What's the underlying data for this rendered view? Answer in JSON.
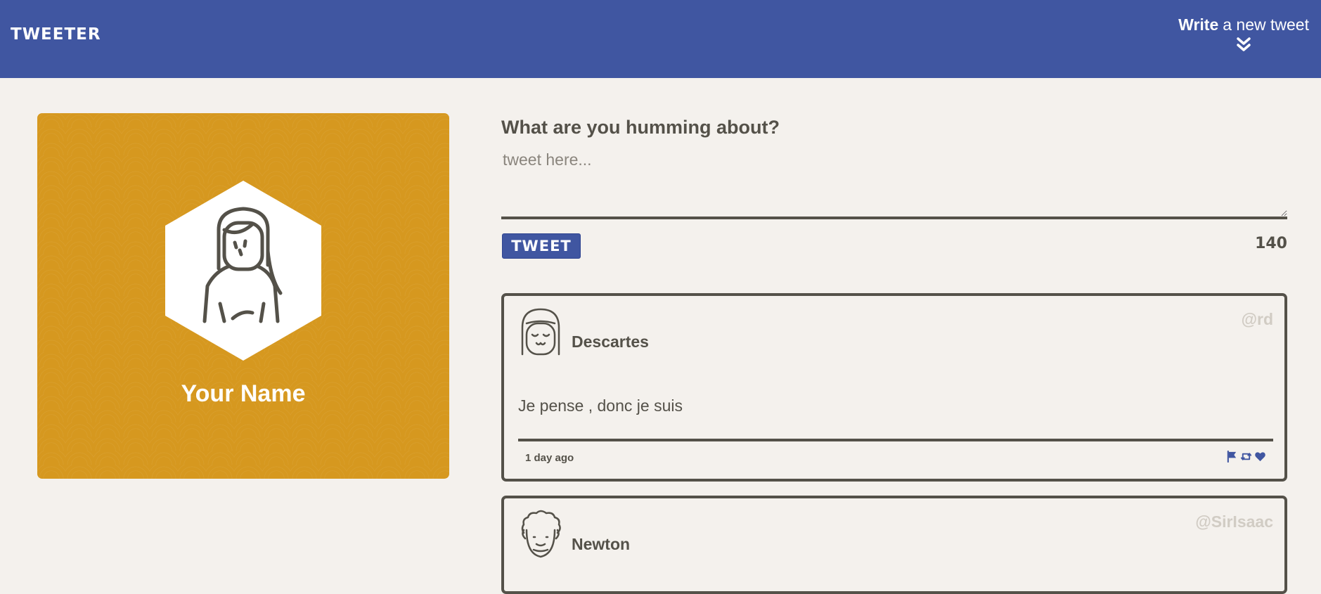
{
  "navbar": {
    "brand": "TWEETER",
    "compose_strong": "Write",
    "compose_rest": "a new tweet",
    "background": "#4056a1"
  },
  "profile": {
    "name": "Your Name",
    "card_color": "#d6981f"
  },
  "compose": {
    "label": "What are you humming about?",
    "placeholder": "tweet here...",
    "button_label": "TWEET",
    "counter": "140"
  },
  "tweets": [
    {
      "author": "Descartes",
      "handle": "@rd",
      "content": "Je pense , donc je suis",
      "timestamp": "1 day ago",
      "avatar_icon": "girl-bangs-avatar-icon",
      "actions": [
        "flag-icon",
        "retweet-icon",
        "heart-icon"
      ]
    },
    {
      "author": "Newton",
      "handle": "@SirIsaac",
      "avatar_icon": "curly-hair-avatar-icon"
    }
  ],
  "colors": {
    "accent": "#4056a1",
    "text": "#545149",
    "background": "#f4f1ed",
    "handle": "#d1ccc4"
  }
}
